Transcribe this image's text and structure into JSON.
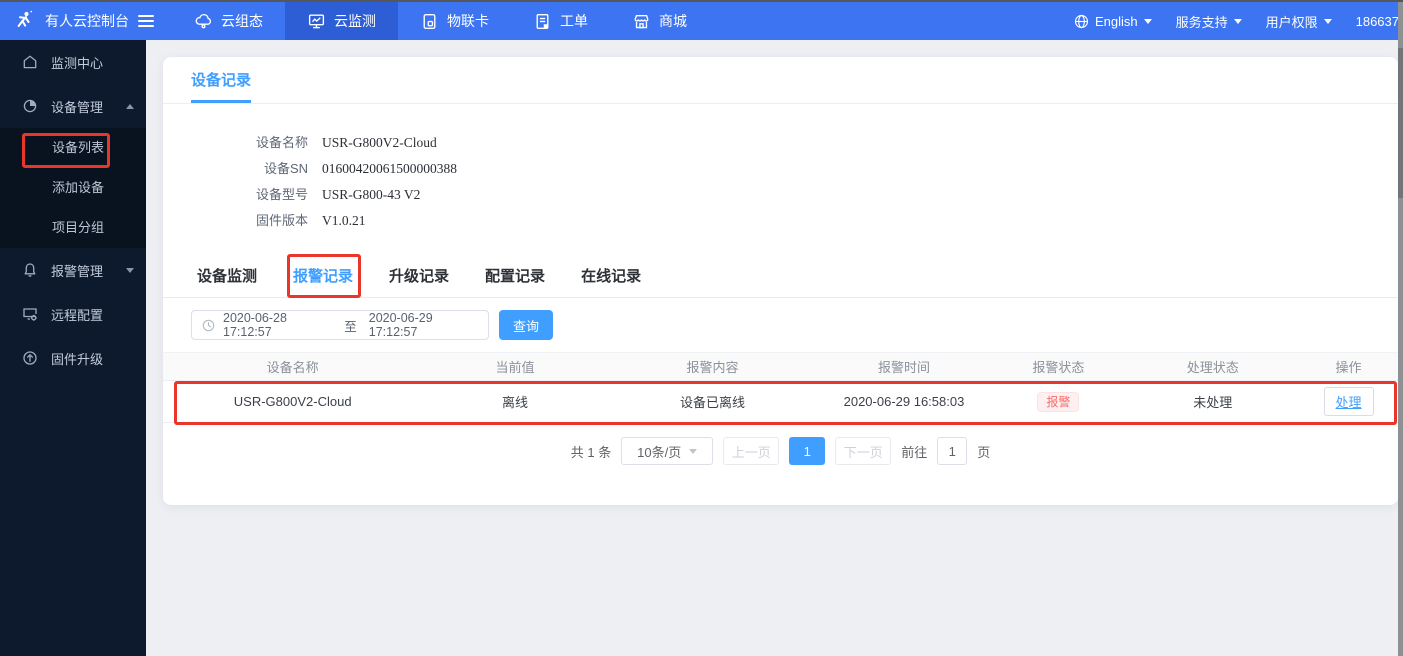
{
  "colors": {
    "navbar_bg": "#3c74f2",
    "navbar_active_bg": "#2d5ed6",
    "sidebar_bg": "#0d1a2d",
    "accent_blue": "#409eff",
    "danger_red": "#f56c6c",
    "annotation_red": "#e8372a"
  },
  "icons": {
    "brand": "running-person-logo",
    "menu": "hamburger-icon",
    "tabs": [
      "cloud-icon",
      "monitor-chart-icon",
      "sim-card-icon",
      "work-order-icon",
      "storefront-icon"
    ],
    "language": "globe-icon",
    "sidebar": [
      "home-icon",
      "pie-chart-icon",
      "alarm-bell-icon",
      "remote-config-icon",
      "firmware-upgrade-icon"
    ],
    "filter": "clock-icon"
  },
  "navbar": {
    "brand": "有人云控制台",
    "tabs": [
      {
        "label": "云组态"
      },
      {
        "label": "云监测"
      },
      {
        "label": "物联卡"
      },
      {
        "label": "工单"
      },
      {
        "label": "商城"
      }
    ],
    "language": "English",
    "support": "服务支持",
    "permission": "用户权限",
    "account": "186637"
  },
  "sidebar": {
    "items": [
      {
        "label": "监测中心"
      },
      {
        "label": "设备管理"
      },
      {
        "label": "报警管理"
      },
      {
        "label": "远程配置"
      },
      {
        "label": "固件升级"
      }
    ],
    "device_submenu": [
      {
        "label": "设备列表"
      },
      {
        "label": "添加设备"
      },
      {
        "label": "项目分组"
      }
    ]
  },
  "card": {
    "title": "设备记录",
    "info": [
      {
        "label": "设备名称",
        "value": "USR-G800V2-Cloud"
      },
      {
        "label": "设备SN",
        "value": "01600420061500000388"
      },
      {
        "label": "设备型号",
        "value": "USR-G800-43 V2"
      },
      {
        "label": "固件版本",
        "value": "V1.0.21"
      }
    ],
    "tabs": [
      {
        "label": "设备监测"
      },
      {
        "label": "报警记录"
      },
      {
        "label": "升级记录"
      },
      {
        "label": "配置记录"
      },
      {
        "label": "在线记录"
      }
    ],
    "filter": {
      "start": "2020-06-28 17:12:57",
      "separator": "至",
      "end": "2020-06-29 17:12:57",
      "search": "查询"
    },
    "table": {
      "columns": [
        "设备名称",
        "当前值",
        "报警内容",
        "报警时间",
        "报警状态",
        "处理状态",
        "操作"
      ],
      "row": {
        "device_name": "USR-G800V2-Cloud",
        "current_value": "离线",
        "alarm_content": "设备已离线",
        "alarm_time": "2020-06-29 16:58:03",
        "alarm_status": "报警",
        "handle_status": "未处理",
        "action": "处理"
      }
    },
    "pagination": {
      "total": "共 1 条",
      "page_size": "10条/页",
      "prev": "上一页",
      "current": "1",
      "next": "下一页",
      "goto_label": "前往",
      "goto_value": "1",
      "page_unit": "页"
    }
  }
}
